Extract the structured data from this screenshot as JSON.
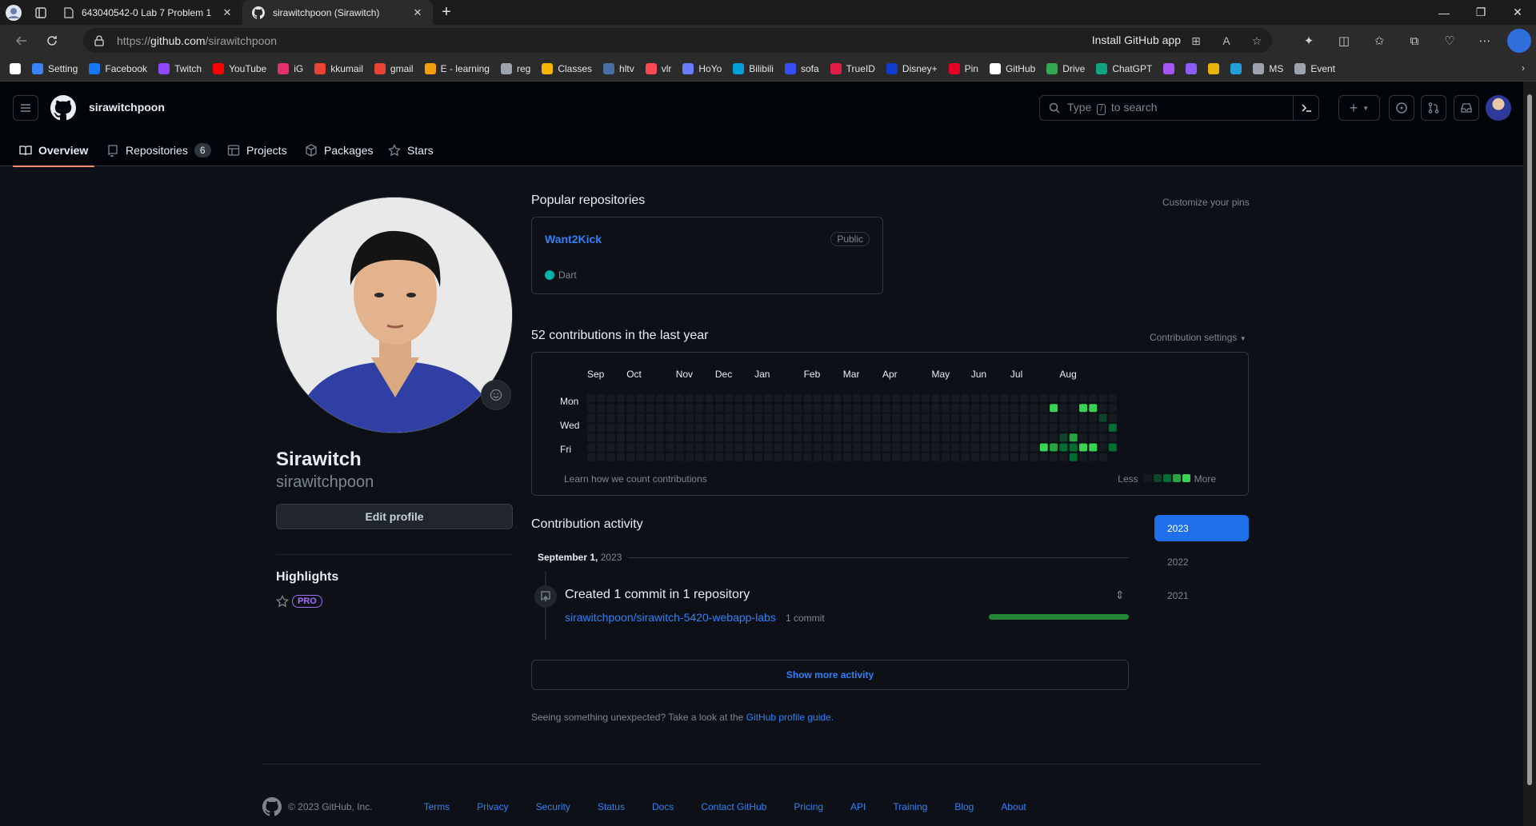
{
  "browser": {
    "tabs": [
      {
        "title": "643040542-0 Lab 7 Problem 1",
        "active": false,
        "icon": "document-icon"
      },
      {
        "title": "sirawitchpoon (Sirawitch)",
        "active": true,
        "icon": "github-icon"
      }
    ],
    "url_prefix": "https://",
    "url_host": "github.com",
    "url_path": "/sirawitchpoon",
    "install_app": "Install GitHub app",
    "bookmarks": [
      {
        "label": "",
        "icon": "x-icon",
        "color": "#ffffff"
      },
      {
        "label": "Setting",
        "icon": "gear-icon",
        "color": "#3b82f6"
      },
      {
        "label": "Facebook",
        "icon": "facebook-icon",
        "color": "#1877f2"
      },
      {
        "label": "Twitch",
        "icon": "twitch-icon",
        "color": "#9146ff"
      },
      {
        "label": "YouTube",
        "icon": "youtube-icon",
        "color": "#ff0000"
      },
      {
        "label": "iG",
        "icon": "instagram-icon",
        "color": "#e1306c"
      },
      {
        "label": "kkumail",
        "icon": "gmail-icon",
        "color": "#ea4335"
      },
      {
        "label": "gmail",
        "icon": "gmail-icon",
        "color": "#ea4335"
      },
      {
        "label": "E - learning",
        "icon": "flame-icon",
        "color": "#f59e0b"
      },
      {
        "label": "reg",
        "icon": "page-icon",
        "color": "#9ca3af"
      },
      {
        "label": "Classes",
        "icon": "classroom-icon",
        "color": "#f4b400"
      },
      {
        "label": "hltv",
        "icon": "hltv-icon",
        "color": "#4a6fa5"
      },
      {
        "label": "vlr",
        "icon": "vlr-icon",
        "color": "#ff4655"
      },
      {
        "label": "HoYo",
        "icon": "hoyo-icon",
        "color": "#6a7cff"
      },
      {
        "label": "Bilibili",
        "icon": "bilibili-icon",
        "color": "#00a1d6"
      },
      {
        "label": "sofa",
        "icon": "sofa-icon",
        "color": "#374df5"
      },
      {
        "label": "TrueID",
        "icon": "trueid-icon",
        "color": "#e11d48"
      },
      {
        "label": "Disney+",
        "icon": "disney-icon",
        "color": "#113ccf"
      },
      {
        "label": "Pin",
        "icon": "pinterest-icon",
        "color": "#e60023"
      },
      {
        "label": "GitHub",
        "icon": "github-icon",
        "color": "#ffffff"
      },
      {
        "label": "Drive",
        "icon": "drive-icon",
        "color": "#34a853"
      },
      {
        "label": "ChatGPT",
        "icon": "chatgpt-icon",
        "color": "#10a37f"
      },
      {
        "label": "",
        "icon": "app-icon",
        "color": "#a855f7"
      },
      {
        "label": "",
        "icon": "app-icon",
        "color": "#8b5cf6"
      },
      {
        "label": "",
        "icon": "app-icon",
        "color": "#eab308"
      },
      {
        "label": "",
        "icon": "telegram-icon",
        "color": "#229ed9"
      },
      {
        "label": "MS",
        "icon": "ms-icon",
        "color": "#9ca3af"
      },
      {
        "label": "Event",
        "icon": "event-icon",
        "color": "#9ca3af"
      }
    ]
  },
  "header": {
    "username": "sirawitchpoon",
    "search_prefix": "Type",
    "search_key": "/",
    "search_suffix": "to search"
  },
  "nav": {
    "tabs": [
      {
        "label": "Overview",
        "icon": "book-icon",
        "selected": true
      },
      {
        "label": "Repositories",
        "icon": "repo-icon",
        "count": "6"
      },
      {
        "label": "Projects",
        "icon": "table-icon"
      },
      {
        "label": "Packages",
        "icon": "package-icon"
      },
      {
        "label": "Stars",
        "icon": "star-icon"
      }
    ]
  },
  "profile": {
    "name": "Sirawitch",
    "login": "sirawitchpoon",
    "edit_label": "Edit profile",
    "highlights_title": "Highlights",
    "pro_badge": "PRO"
  },
  "popular": {
    "title": "Popular repositories",
    "customize": "Customize your pins",
    "repos": [
      {
        "name": "Want2Kick",
        "visibility": "Public",
        "language": "Dart",
        "language_color": "#00b4ab"
      }
    ]
  },
  "contributions": {
    "title": "52 contributions in the last year",
    "settings": "Contribution settings",
    "months": [
      "Sep",
      "Oct",
      "Nov",
      "Dec",
      "Jan",
      "Feb",
      "Mar",
      "Apr",
      "May",
      "Jun",
      "Jul",
      "Aug"
    ],
    "days": [
      "Mon",
      "Wed",
      "Fri"
    ],
    "learn": "Learn how we count contributions",
    "less": "Less",
    "more": "More",
    "colors": [
      "#161b22",
      "#0e4429",
      "#006d32",
      "#26a641",
      "#39d353"
    ],
    "active_cells": [
      {
        "week": 47,
        "day": 1,
        "level": 4
      },
      {
        "week": 47,
        "day": 5,
        "level": 3
      },
      {
        "week": 46,
        "day": 5,
        "level": 4
      },
      {
        "week": 48,
        "day": 4,
        "level": 1
      },
      {
        "week": 48,
        "day": 5,
        "level": 2
      },
      {
        "week": 49,
        "day": 5,
        "level": 2
      },
      {
        "week": 49,
        "day": 6,
        "level": 2
      },
      {
        "week": 49,
        "day": 4,
        "level": 3
      },
      {
        "week": 50,
        "day": 1,
        "level": 4
      },
      {
        "week": 50,
        "day": 5,
        "level": 4
      },
      {
        "week": 51,
        "day": 1,
        "level": 4
      },
      {
        "week": 51,
        "day": 5,
        "level": 4
      },
      {
        "week": 52,
        "day": 2,
        "level": 1
      },
      {
        "week": 53,
        "day": 3,
        "level": 2
      },
      {
        "week": 53,
        "day": 5,
        "level": 2
      }
    ]
  },
  "activity": {
    "title": "Contribution activity",
    "years": [
      "2023",
      "2022",
      "2021"
    ],
    "date_bold": "September 1,",
    "date_year": "2023",
    "event_title": "Created 1 commit in 1 repository",
    "repo": "sirawitchpoon/sirawitch-5420-webapp-labs",
    "commits": "1 commit",
    "progress": 1.0,
    "show_more": "Show more activity",
    "unexpected_text": "Seeing something unexpected? Take a look at the",
    "unexpected_link": "GitHub profile guide."
  },
  "footer": {
    "copyright": "© 2023 GitHub, Inc.",
    "links": [
      "Terms",
      "Privacy",
      "Security",
      "Status",
      "Docs",
      "Contact GitHub",
      "Pricing",
      "API",
      "Training",
      "Blog",
      "About"
    ]
  }
}
